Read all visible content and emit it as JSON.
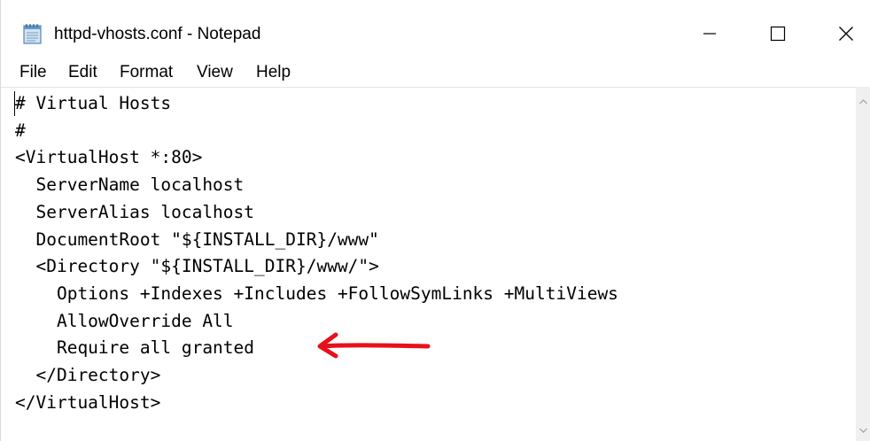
{
  "window": {
    "title": "httpd-vhosts.conf - Notepad",
    "icon": "notepad-icon",
    "controls": {
      "minimize": "minimize-icon",
      "maximize": "maximize-icon",
      "close": "close-icon"
    }
  },
  "menu": {
    "file": "File",
    "edit": "Edit",
    "format": "Format",
    "view": "View",
    "help": "Help"
  },
  "editor": {
    "lines": [
      "# Virtual Hosts",
      "#",
      "<VirtualHost *:80>",
      "  ServerName localhost",
      "  ServerAlias localhost",
      "  DocumentRoot \"${INSTALL_DIR}/www\"",
      "  <Directory \"${INSTALL_DIR}/www/\">",
      "    Options +Indexes +Includes +FollowSymLinks +MultiViews",
      "    AllowOverride All",
      "    Require all granted",
      "  </Directory>",
      "</VirtualHost>"
    ]
  },
  "annotation": {
    "icon": "red-arrow-icon",
    "color": "#e8101a"
  }
}
